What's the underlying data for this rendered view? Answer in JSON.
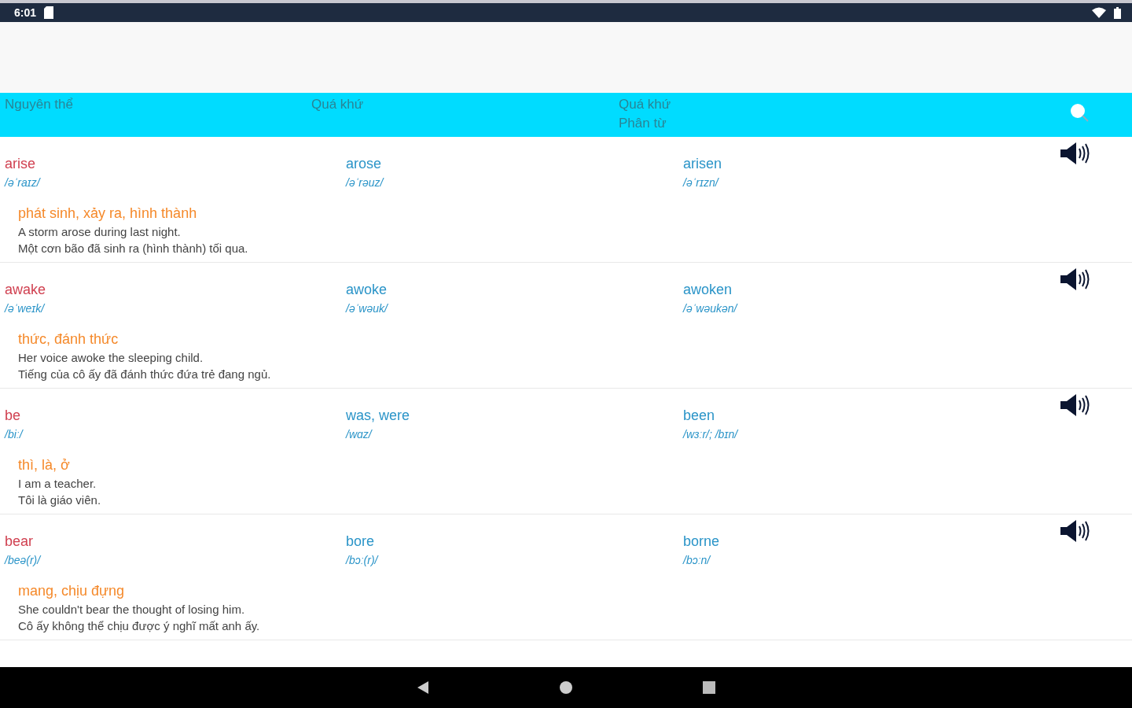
{
  "status_bar": {
    "time": "6:01"
  },
  "header": {
    "columns": [
      "Nguyên thể",
      "Quá khứ",
      "Quá khứ\nPhân từ"
    ]
  },
  "rows": [
    {
      "infinitive": "arise",
      "infinitive_ipa": "/əˈraɪz/",
      "past": "arose",
      "past_ipa": "/əˈrəuz/",
      "participle": "arisen",
      "participle_ipa": "/əˈrɪzn/",
      "meaning": "phát sinh, xảy ra, hình thành",
      "example": "A storm arose during last night.",
      "translation": "Một cơn bão đã sinh ra (hình thành) tối qua."
    },
    {
      "infinitive": "awake",
      "infinitive_ipa": "/əˈweɪk/",
      "past": "awoke",
      "past_ipa": "/əˈwəuk/",
      "participle": "awoken",
      "participle_ipa": "/əˈwəukən/",
      "meaning": "thức, đánh thức",
      "example": "Her voice awoke the sleeping child.",
      "translation": "Tiếng của cô ấy đã đánh thức đứa trẻ đang ngủ."
    },
    {
      "infinitive": "be",
      "infinitive_ipa": "/biː/",
      "past": "was, were",
      "past_ipa": "/wɑz/",
      "participle": "been",
      "participle_ipa": "/wɜːr/; /bɪn/",
      "meaning": "thì, là,  ở",
      "example": "I am a teacher.",
      "translation": "Tôi là giáo viên."
    },
    {
      "infinitive": "bear",
      "infinitive_ipa": "/beə(r)/",
      "past": "bore",
      "past_ipa": "/bɔː(r)/",
      "participle": "borne",
      "participle_ipa": "/bɔːn/",
      "meaning": "mang, chịu đựng",
      "example": "She couldn't bear the thought of losing him.",
      "translation": "Cô ấy không thể chịu được ý nghĩ mất anh ấy."
    }
  ]
}
